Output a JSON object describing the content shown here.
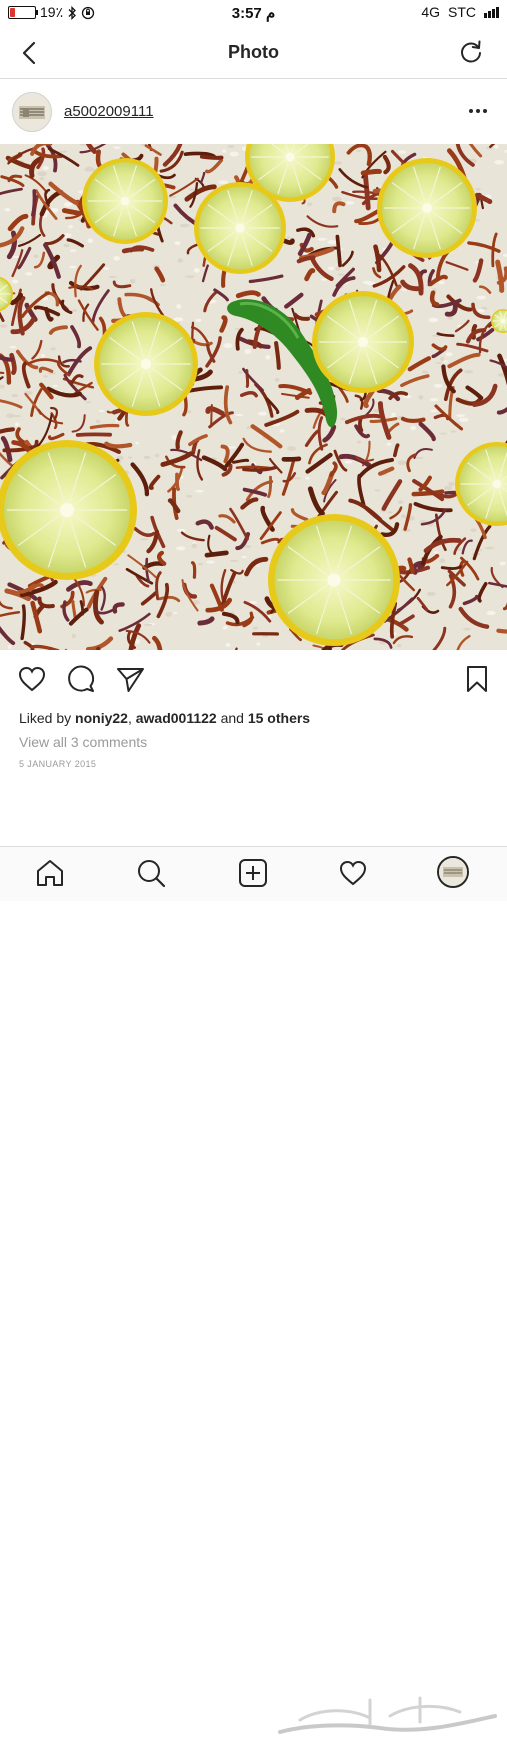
{
  "status_bar": {
    "battery_text": "19٪",
    "battery_level": 0.19,
    "time": "3:57 م",
    "network": "4G",
    "carrier": "STC"
  },
  "nav": {
    "title": "Photo",
    "back_icon": "chevron-left-icon",
    "refresh_icon": "refresh-icon"
  },
  "post": {
    "username": "a5002009111",
    "more_icon": "ellipsis-icon",
    "photo_icon": "food-photo"
  },
  "actions": {
    "like_icon": "heart-icon",
    "comment_icon": "comment-icon",
    "share_icon": "send-icon",
    "save_icon": "bookmark-icon"
  },
  "likes": {
    "prefix": "Liked by ",
    "user1": "noniy22",
    "separator": ", ",
    "user2": "awad001122",
    "middle": " and ",
    "others": "15 others"
  },
  "comments_link": "View all 3 comments",
  "date": "5 JANUARY 2015",
  "tab_bar": {
    "home_icon": "home-icon",
    "search_icon": "search-icon",
    "add_icon": "add-post-icon",
    "activity_icon": "heart-icon",
    "profile_icon": "avatar"
  },
  "colors": {
    "battery_low": "#e0342f",
    "text": "#262626",
    "muted": "#9a9a9a",
    "divider": "#dbdbdb"
  }
}
